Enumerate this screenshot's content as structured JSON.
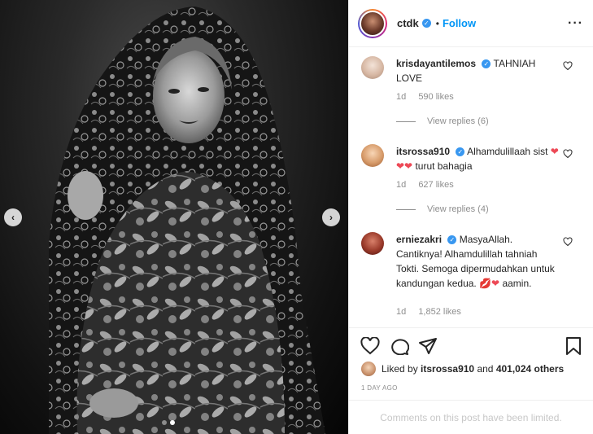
{
  "post": {
    "carousel": {
      "count": 2,
      "active": 1
    }
  },
  "header": {
    "username": "ctdk",
    "separator": "•",
    "follow_label": "Follow",
    "more_icon": "more-horizontal-icon"
  },
  "comments": [
    {
      "username": "krisdayantilemos",
      "text": "TAHNIAH LOVE",
      "time": "1d",
      "likes": "590 likes",
      "replies": "View replies (6)"
    },
    {
      "username": "itsrossa910",
      "text_before": "Alhamdulillaah sist",
      "hearts": "❤❤❤",
      "text_after": "turut bahagia",
      "time": "1d",
      "likes": "627 likes",
      "replies": "View replies (4)"
    },
    {
      "username": "erniezakri",
      "text": "MasyaAllah. Cantiknya! Alhamdulillah tahniah Tokti. Semoga dipermudahkan untuk kandungan kedua.",
      "emoji": "💋❤",
      "text_after": "aamin.",
      "time": "1d",
      "likes": "1,852 likes"
    }
  ],
  "likes_line": {
    "prefix": "Liked by",
    "user": "itsrossa910",
    "middle": "and",
    "others": "401,024 others"
  },
  "time_ago": "1 DAY AGO",
  "comments_limited": "Comments on this post have been limited.",
  "colors": {
    "accent": "#0095f6",
    "verified": "#3897f0",
    "muted": "#8e8e8e",
    "heart": "#ed4956"
  }
}
